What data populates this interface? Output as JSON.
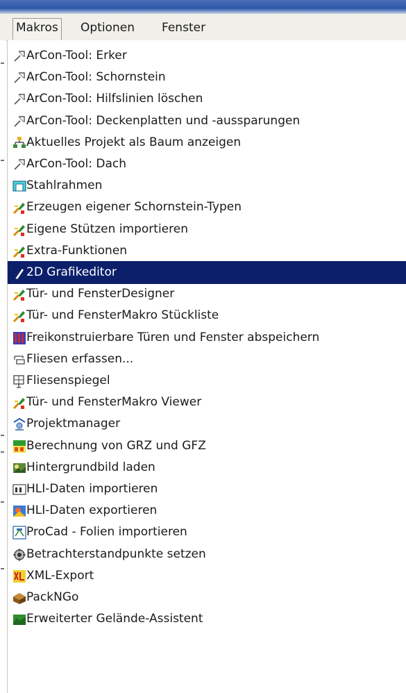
{
  "menubar": {
    "menus": [
      {
        "label": "Makros"
      },
      {
        "label": "Optionen"
      },
      {
        "label": "Fenster"
      }
    ]
  },
  "dropdown": {
    "selected_index": 10,
    "items": [
      {
        "label": "ArCon-Tool: Erker",
        "icon": "wand-icon"
      },
      {
        "label": "ArCon-Tool: Schornstein",
        "icon": "wand-icon"
      },
      {
        "label": "ArCon-Tool: Hilfslinien löschen",
        "icon": "wand-icon"
      },
      {
        "label": "ArCon-Tool: Deckenplatten und -aussparungen",
        "icon": "wand-icon"
      },
      {
        "label": "Aktuelles Projekt als Baum anzeigen",
        "icon": "tree-icon"
      },
      {
        "label": "ArCon-Tool: Dach",
        "icon": "wand-icon"
      },
      {
        "label": "Stahlrahmen",
        "icon": "steel-frame-icon"
      },
      {
        "label": "Erzeugen eigener Schornstein-Typen",
        "icon": "tool-icon"
      },
      {
        "label": "Eigene Stützen importieren",
        "icon": "tool-icon"
      },
      {
        "label": "Extra-Funktionen",
        "icon": "tool-icon"
      },
      {
        "label": "2D Grafikeditor",
        "icon": "pen-icon"
      },
      {
        "label": "Tür- und FensterDesigner",
        "icon": "tool-icon"
      },
      {
        "label": "Tür- und FensterMakro Stückliste",
        "icon": "tool-icon"
      },
      {
        "label": "Freikonstruierbare Türen und Fenster abspeichern",
        "icon": "door-window-icon"
      },
      {
        "label": "Fliesen erfassen...",
        "icon": "tiles-icon"
      },
      {
        "label": "Fliesenspiegel",
        "icon": "tile-mirror-icon"
      },
      {
        "label": "Tür- und FensterMakro Viewer",
        "icon": "tool-icon"
      },
      {
        "label": "Projektmanager",
        "icon": "project-manager-icon"
      },
      {
        "label": "Berechnung von GRZ und GFZ",
        "icon": "calculation-icon"
      },
      {
        "label": "Hintergrundbild laden",
        "icon": "background-image-icon"
      },
      {
        "label": "HLI-Daten importieren",
        "icon": "import-icon"
      },
      {
        "label": "HLI-Daten exportieren",
        "icon": "export-icon"
      },
      {
        "label": "ProCad - Folien importieren",
        "icon": "procad-icon"
      },
      {
        "label": "Betrachterstandpunkte setzen",
        "icon": "viewpoint-icon"
      },
      {
        "label": "XML-Export",
        "icon": "xml-icon"
      },
      {
        "label": "PackNGo",
        "icon": "package-icon"
      },
      {
        "label": "Erweiterter Gelände-Assistent",
        "icon": "terrain-icon"
      }
    ]
  },
  "colors": {
    "selection_background": "#0c1f6b",
    "menubar_background": "#f0efe9"
  }
}
